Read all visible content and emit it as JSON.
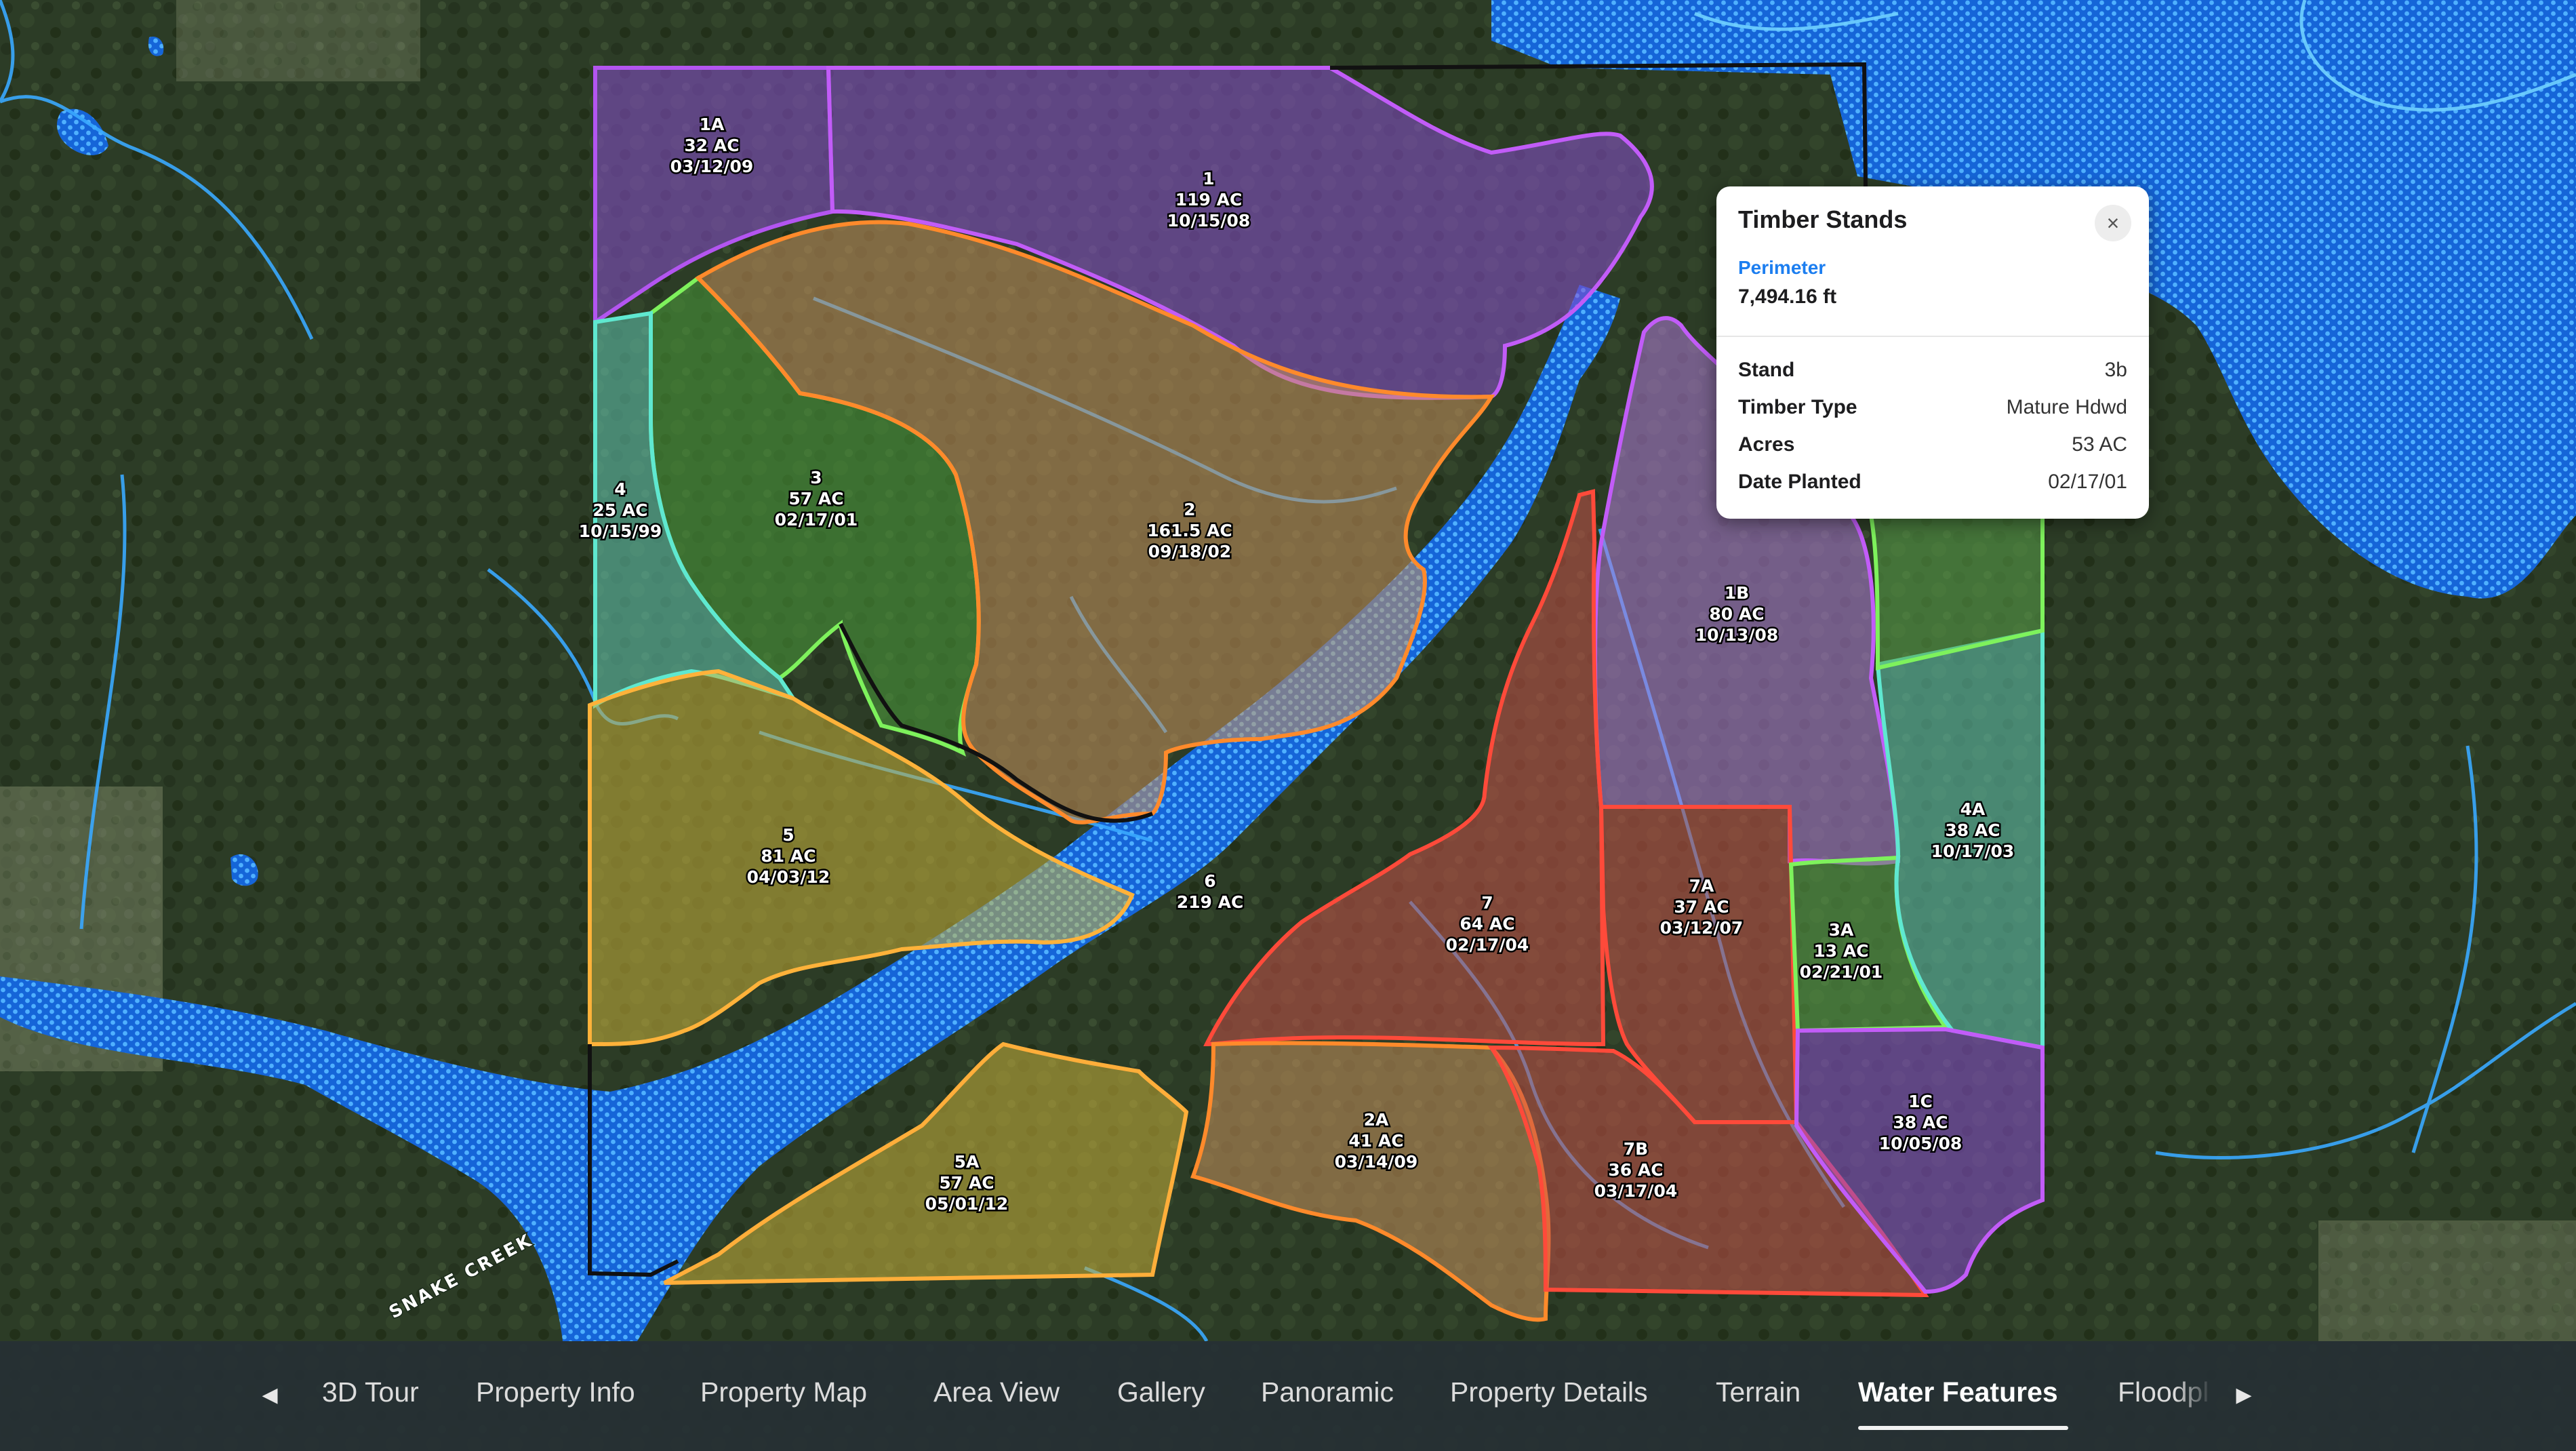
{
  "colors": {
    "aerial_base": "#2f3f2a",
    "forest_dark": "#27361f",
    "water_fill": "#1a6fe0",
    "stream_line": "#3aa9ff",
    "boundary_black": "#111111",
    "accent_blue": "#1c7ef0"
  },
  "map": {
    "creek_label": "SNAKE CREEK",
    "stands": [
      {
        "id": "1A",
        "area": "32 AC",
        "date": "03/12/09",
        "fill": "#8a4fd0",
        "stroke": "#b355f0"
      },
      {
        "id": "1",
        "area": "119 AC",
        "date": "10/15/08",
        "fill": "#8a4fd0",
        "stroke": "#c25cf8"
      },
      {
        "id": "3",
        "area": "57 AC",
        "date": "02/17/01",
        "fill": "#4a9a3a",
        "stroke": "#7ef25c"
      },
      {
        "id": "2",
        "area": "161.5 AC",
        "date": "09/18/02",
        "fill": "#c8915c",
        "stroke": "#ff8a2b"
      },
      {
        "id": "4",
        "area": "25 AC",
        "date": "10/15/99",
        "fill": "#62c7b0",
        "stroke": "#5fe8d0"
      },
      {
        "id": "5",
        "area": "81 AC",
        "date": "04/03/12",
        "fill": "#c9b13a",
        "stroke": "#ffb23a"
      },
      {
        "id": "6",
        "area": "219 AC",
        "date": "",
        "fill": "#16305a",
        "stroke": "#111111"
      },
      {
        "id": "5A",
        "area": "57 AC",
        "date": "05/01/12",
        "fill": "#c9b13a",
        "stroke": "#ffae3a"
      },
      {
        "id": "1B",
        "area": "80 AC",
        "date": "10/13/08",
        "fill": "#b07ad8",
        "stroke": "#c25cf8"
      },
      {
        "id": "7",
        "area": "64 AC",
        "date": "02/17/04",
        "fill": "#c65048",
        "stroke": "#ff4a3a"
      },
      {
        "id": "7A",
        "area": "37 AC",
        "date": "03/12/07",
        "fill": "#c65048",
        "stroke": "#ff4a3a"
      },
      {
        "id": "3A",
        "area": "13 AC",
        "date": "02/21/01",
        "fill": "#5aa048",
        "stroke": "#7ef25c"
      },
      {
        "id": "4A",
        "area": "38 AC",
        "date": "10/17/03",
        "fill": "#62c7b0",
        "stroke": "#5fe8d0"
      },
      {
        "id": "2A",
        "area": "41 AC",
        "date": "03/14/09",
        "fill": "#c8915c",
        "stroke": "#ff8a2b"
      },
      {
        "id": "7B",
        "area": "36 AC",
        "date": "03/17/04",
        "fill": "#c65048",
        "stroke": "#ff4a3a"
      },
      {
        "id": "1C",
        "area": "38 AC",
        "date": "10/05/08",
        "fill": "#8a4fd0",
        "stroke": "#c25cf8"
      },
      {
        "id": "3b",
        "area": "",
        "date": "",
        "fill": "#5aa048",
        "stroke": "#7ef25c"
      }
    ]
  },
  "popup": {
    "title": "Timber Stands",
    "close_icon": "×",
    "perimeter_label": "Perimeter",
    "perimeter_value": "7,494.16 ft",
    "rows": [
      {
        "key": "Stand",
        "value": "3b"
      },
      {
        "key": "Timber Type",
        "value": "Mature Hdwd"
      },
      {
        "key": "Acres",
        "value": "53 AC"
      },
      {
        "key": "Date Planted",
        "value": "02/17/01"
      }
    ]
  },
  "nav": {
    "prev_icon": "◀",
    "next_icon": "▶",
    "tabs": [
      "3D Tour",
      "Property Info",
      "Property Map",
      "Area View",
      "Gallery",
      "Panoramic",
      "Property Details",
      "Terrain",
      "Water Features",
      "Floodpl"
    ],
    "active_tab": "Water Features"
  }
}
